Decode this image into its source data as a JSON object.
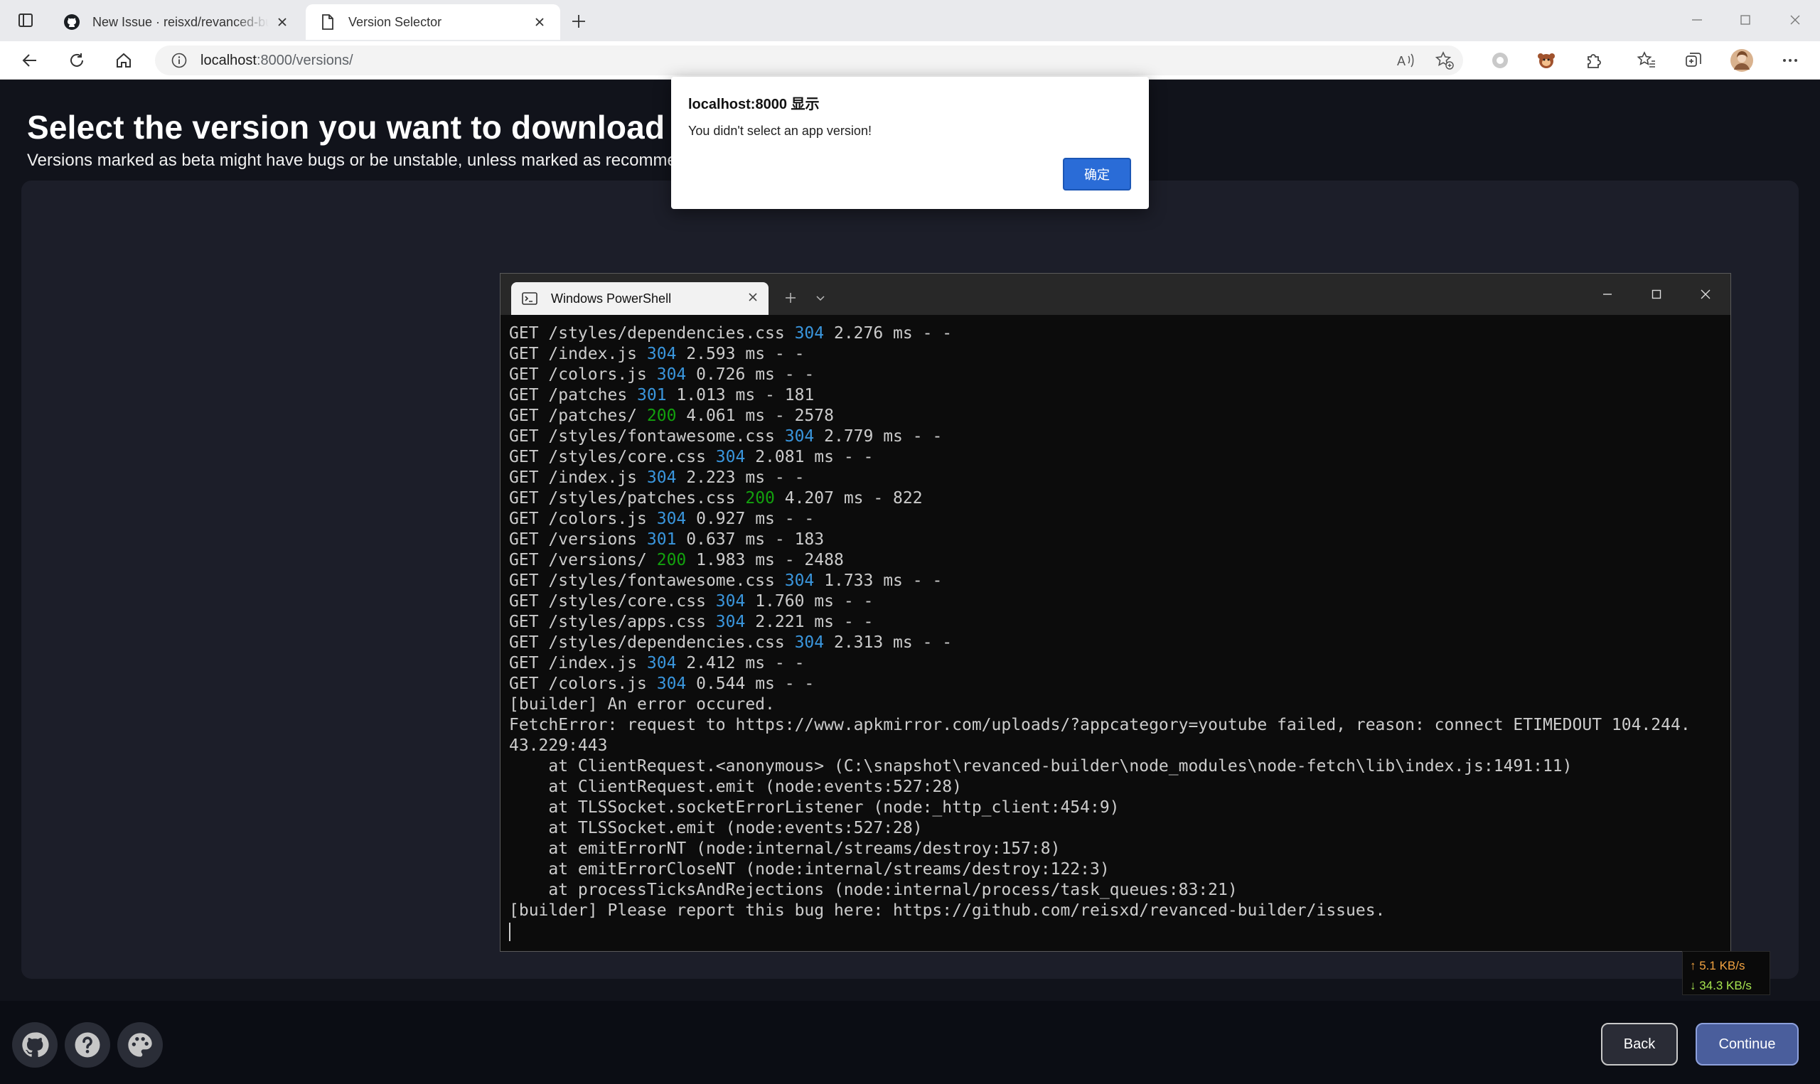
{
  "browser": {
    "tabs": [
      {
        "title": "New Issue · reisxd/revanced-builder",
        "active": false,
        "icon": "github-icon"
      },
      {
        "title": "Version Selector",
        "active": true,
        "icon": "page-icon"
      }
    ],
    "url_host": "localhost",
    "url_path": ":8000/versions/",
    "extensions": [
      "read-aloud-icon",
      "favorite-add-icon",
      "record-icon",
      "monkey-extension-icon",
      "extensions-icon",
      "favorites-icon",
      "collections-icon",
      "profile-avatar",
      "more-icon"
    ]
  },
  "page": {
    "title": "Select the version you want to download",
    "subtitle": "Versions marked as beta might have bugs or be unstable, unless marked as recommended"
  },
  "footer": {
    "icons": [
      "github-icon",
      "help-icon",
      "palette-icon"
    ],
    "back_label": "Back",
    "continue_label": "Continue"
  },
  "alert": {
    "title": "localhost:8000 显示",
    "message": "You didn't select an app version!",
    "ok_label": "确定"
  },
  "terminal": {
    "tab_title": "Windows PowerShell",
    "lines": [
      {
        "pre": "GET /styles/dependencies.css ",
        "code": "304",
        "post": " 2.276 ms - -"
      },
      {
        "pre": "GET /index.js ",
        "code": "304",
        "post": " 2.593 ms - -"
      },
      {
        "pre": "GET /colors.js ",
        "code": "304",
        "post": " 0.726 ms - -"
      },
      {
        "pre": "GET /patches ",
        "code": "301",
        "post": " 1.013 ms - 181"
      },
      {
        "pre": "GET /patches/ ",
        "code": "200",
        "post": " 4.061 ms - 2578"
      },
      {
        "pre": "GET /styles/fontawesome.css ",
        "code": "304",
        "post": " 2.779 ms - -"
      },
      {
        "pre": "GET /styles/core.css ",
        "code": "304",
        "post": " 2.081 ms - -"
      },
      {
        "pre": "GET /index.js ",
        "code": "304",
        "post": " 2.223 ms - -"
      },
      {
        "pre": "GET /styles/patches.css ",
        "code": "200",
        "post": " 4.207 ms - 822"
      },
      {
        "pre": "GET /colors.js ",
        "code": "304",
        "post": " 0.927 ms - -"
      },
      {
        "pre": "GET /versions ",
        "code": "301",
        "post": " 0.637 ms - 183"
      },
      {
        "pre": "GET /versions/ ",
        "code": "200",
        "post": " 1.983 ms - 2488"
      },
      {
        "pre": "GET /styles/fontawesome.css ",
        "code": "304",
        "post": " 1.733 ms - -"
      },
      {
        "pre": "GET /styles/core.css ",
        "code": "304",
        "post": " 1.760 ms - -"
      },
      {
        "pre": "GET /styles/apps.css ",
        "code": "304",
        "post": " 2.221 ms - -"
      },
      {
        "pre": "GET /styles/dependencies.css ",
        "code": "304",
        "post": " 2.313 ms - -"
      },
      {
        "pre": "GET /index.js ",
        "code": "304",
        "post": " 2.412 ms - -"
      },
      {
        "pre": "GET /colors.js ",
        "code": "304",
        "post": " 0.544 ms - -"
      },
      {
        "pre": "[builder] An error occured.",
        "code": "",
        "post": ""
      },
      {
        "pre": "FetchError: request to https://www.apkmirror.com/uploads/?appcategory=youtube failed, reason: connect ETIMEDOUT 104.244.",
        "code": "",
        "post": ""
      },
      {
        "pre": "43.229:443",
        "code": "",
        "post": ""
      },
      {
        "pre": "    at ClientRequest.<anonymous> (C:\\snapshot\\revanced-builder\\node_modules\\node-fetch\\lib\\index.js:1491:11)",
        "code": "",
        "post": ""
      },
      {
        "pre": "    at ClientRequest.emit (node:events:527:28)",
        "code": "",
        "post": ""
      },
      {
        "pre": "    at TLSSocket.socketErrorListener (node:_http_client:454:9)",
        "code": "",
        "post": ""
      },
      {
        "pre": "    at TLSSocket.emit (node:events:527:28)",
        "code": "",
        "post": ""
      },
      {
        "pre": "    at emitErrorNT (node:internal/streams/destroy:157:8)",
        "code": "",
        "post": ""
      },
      {
        "pre": "    at emitErrorCloseNT (node:internal/streams/destroy:122:3)",
        "code": "",
        "post": ""
      },
      {
        "pre": "    at processTicksAndRejections (node:internal/process/task_queues:83:21)",
        "code": "",
        "post": ""
      },
      {
        "pre": "[builder] Please report this bug here: https://github.com/reisxd/revanced-builder/issues.",
        "code": "",
        "post": ""
      }
    ]
  },
  "netspeed": {
    "up": "↑ 5.1 KB/s",
    "down": "↓ 34.3 KB/s"
  },
  "colors": {
    "page_bg": "#11131b",
    "panel_bg": "#1c1e29",
    "continue_bg": "#4a5e9c",
    "alert_button": "#2a6cd7",
    "status_200": "#13a10e",
    "status_3xx": "#3a96dd"
  }
}
